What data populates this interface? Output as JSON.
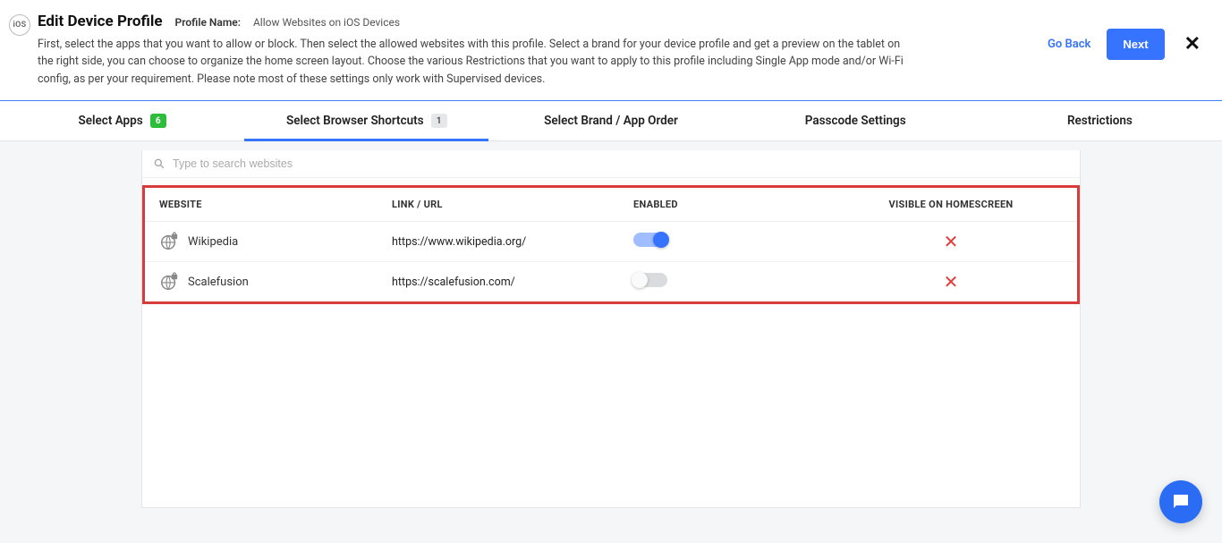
{
  "header": {
    "ios_badge": "iOS",
    "title": "Edit Device Profile",
    "profile_name_label": "Profile Name:",
    "profile_name_value": "Allow Websites on iOS Devices",
    "description": "First, select the apps that you want to allow or block. Then select the allowed websites with this profile. Select a brand for your device profile and get a preview on the tablet on the right side, you can choose to organize the home screen layout. Choose the various Restrictions that you want to apply to this profile including Single App mode and/or Wi-Fi config, as per your requirement. Please note most of these settings only work with Supervised devices.",
    "go_back": "Go Back",
    "next": "Next"
  },
  "tabs": {
    "select_apps": {
      "label": "Select Apps",
      "count": "6"
    },
    "select_browser": {
      "label": "Select Browser Shortcuts",
      "count": "1"
    },
    "select_brand": {
      "label": "Select Brand / App Order"
    },
    "passcode": {
      "label": "Passcode Settings"
    },
    "restrictions": {
      "label": "Restrictions"
    }
  },
  "search": {
    "placeholder": "Type to search websites"
  },
  "table": {
    "headers": {
      "website": "WEBSITE",
      "url": "LINK / URL",
      "enabled": "ENABLED",
      "visible": "VISIBLE ON HOMESCREEN"
    },
    "rows": [
      {
        "name": "Wikipedia",
        "url": "https://www.wikipedia.org/",
        "enabled": true
      },
      {
        "name": "Scalefusion",
        "url": "https://scalefusion.com/",
        "enabled": false
      }
    ]
  }
}
